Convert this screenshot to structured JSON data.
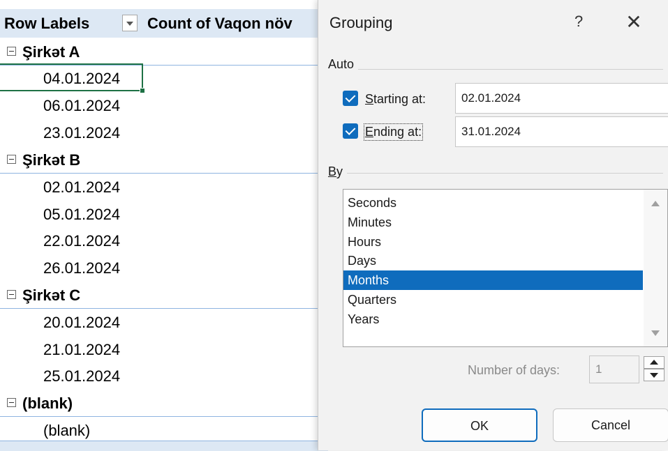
{
  "pivot": {
    "header": {
      "row_labels": "Row Labels",
      "count_label": "Count of Vaqon növ"
    },
    "rows": [
      {
        "type": "group",
        "label": "Şirkət A"
      },
      {
        "type": "item",
        "label": "04.01.2024"
      },
      {
        "type": "item",
        "label": "06.01.2024"
      },
      {
        "type": "item",
        "label": "23.01.2024"
      },
      {
        "type": "group",
        "label": "Şirkət B"
      },
      {
        "type": "item",
        "label": "02.01.2024"
      },
      {
        "type": "item",
        "label": "05.01.2024"
      },
      {
        "type": "item",
        "label": "22.01.2024"
      },
      {
        "type": "item",
        "label": "26.01.2024"
      },
      {
        "type": "group",
        "label": "Şirkət C"
      },
      {
        "type": "item",
        "label": "20.01.2024"
      },
      {
        "type": "item",
        "label": "21.01.2024"
      },
      {
        "type": "item",
        "label": "25.01.2024"
      },
      {
        "type": "group",
        "label": "(blank)"
      },
      {
        "type": "item",
        "label": "(blank)"
      }
    ]
  },
  "dialog": {
    "title": "Grouping",
    "help": "?",
    "close": "✕",
    "auto": {
      "label": "Auto",
      "starting_checked": true,
      "starting_label": "tarting at:",
      "starting_accel": "S",
      "starting_value": "02.01.2024",
      "ending_checked": true,
      "ending_label": "nding at:",
      "ending_accel": "E",
      "ending_value": "31.01.2024"
    },
    "by": {
      "label_accel": "B",
      "label_rest": "y",
      "options": [
        "Seconds",
        "Minutes",
        "Hours",
        "Days",
        "Months",
        "Quarters",
        "Years"
      ],
      "selected": "Months"
    },
    "days": {
      "label": "Number of days:",
      "value": "1"
    },
    "ok_label": "OK",
    "cancel_label": "Cancel"
  }
}
